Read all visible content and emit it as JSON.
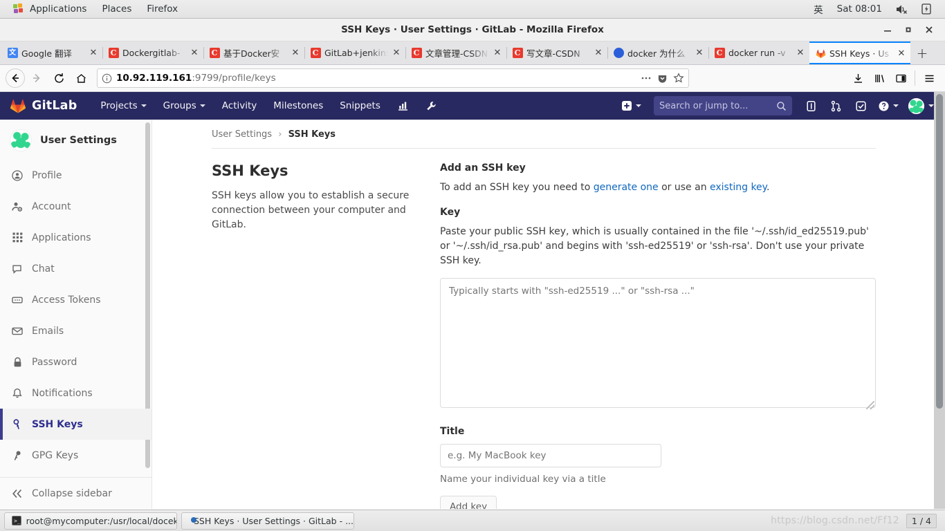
{
  "desktop": {
    "menus": [
      {
        "label": "Applications",
        "icon": "applications-icon"
      },
      {
        "label": "Places",
        "icon": "places-icon"
      },
      {
        "label": "Firefox",
        "icon": "firefox-menu-icon"
      }
    ],
    "indicators": {
      "input_method": "英",
      "clock": "Sat 08:01",
      "volume_icon": "volume-muted-icon",
      "battery_icon": "battery-charging-icon"
    }
  },
  "window": {
    "title": "SSH Keys · User Settings · GitLab - Mozilla Firefox",
    "controls": {
      "minimize": "minimize-icon",
      "maximize": "maximize-icon",
      "close": "close-icon"
    }
  },
  "browser": {
    "tabs": [
      {
        "label": "Google 翻译",
        "favicon": "google-translate",
        "active": false
      },
      {
        "label": "Dockergitlab-",
        "favicon": "csdn",
        "active": false
      },
      {
        "label": "基于Docker安",
        "favicon": "csdn",
        "active": false
      },
      {
        "label": "GitLab+jenkins",
        "favicon": "csdn",
        "active": false
      },
      {
        "label": "文章管理-CSDN",
        "favicon": "csdn",
        "active": false
      },
      {
        "label": "写文章-CSDN",
        "favicon": "csdn",
        "active": false
      },
      {
        "label": "docker 为什么",
        "favicon": "baidu",
        "active": false
      },
      {
        "label": "docker run -v",
        "favicon": "csdn",
        "active": false
      },
      {
        "label": "SSH Keys · Us",
        "favicon": "gitlab",
        "active": true
      }
    ],
    "new_tab_label": "+",
    "close_glyph": "✕",
    "toolbar": {
      "back_icon": "back-arrow-icon",
      "forward_icon": "forward-arrow-icon",
      "reload_icon": "reload-icon",
      "home_icon": "home-icon",
      "downloads_icon": "download-icon",
      "library_icon": "library-icon",
      "sidebar_icon": "sidebar-icon",
      "menu_icon": "hamburger-menu-icon"
    },
    "urlbar": {
      "info_icon": "page-info-icon",
      "host": "10.92.119.161",
      "rest": ":9799/profile/keys",
      "page_actions_icon": "ellipsis-icon",
      "pocket_icon": "pocket-icon",
      "bookmark_icon": "star-icon"
    }
  },
  "gitlab": {
    "brand": "GitLab",
    "nav": [
      {
        "label": "Projects",
        "caret": true
      },
      {
        "label": "Groups",
        "caret": true
      },
      {
        "label": "Activity",
        "caret": false
      },
      {
        "label": "Milestones",
        "caret": false
      },
      {
        "label": "Snippets",
        "caret": false
      }
    ],
    "nav_icons": [
      "analytics-icon",
      "wrench-icon"
    ],
    "right": {
      "new_label": "",
      "plus_icon": "plus-square-icon",
      "search_placeholder": "Search or jump to...",
      "search_icon": "search-icon",
      "issues_icon": "issues-icon",
      "merge_requests_icon": "merge-request-icon",
      "todos_icon": "todos-checkbox-icon",
      "help_icon": "help-question-icon",
      "avatar": "user-avatar"
    }
  },
  "sidebar": {
    "title": "User Settings",
    "avatar": "user-avatar",
    "items": [
      {
        "label": "Profile",
        "icon": "profile-icon",
        "active": false
      },
      {
        "label": "Account",
        "icon": "account-icon",
        "active": false
      },
      {
        "label": "Applications",
        "icon": "applications-grid-icon",
        "active": false
      },
      {
        "label": "Chat",
        "icon": "chat-bubble-icon",
        "active": false
      },
      {
        "label": "Access Tokens",
        "icon": "access-token-icon",
        "active": false
      },
      {
        "label": "Emails",
        "icon": "envelope-icon",
        "active": false
      },
      {
        "label": "Password",
        "icon": "lock-icon",
        "active": false
      },
      {
        "label": "Notifications",
        "icon": "bell-icon",
        "active": false
      },
      {
        "label": "SSH Keys",
        "icon": "key-icon",
        "active": true
      },
      {
        "label": "GPG Keys",
        "icon": "gpg-key-icon",
        "active": false
      }
    ],
    "collapse": {
      "label": "Collapse sidebar",
      "icon": "double-chevron-left-icon"
    }
  },
  "content": {
    "breadcrumb": {
      "root": "User Settings",
      "separator": "›",
      "current": "SSH Keys"
    },
    "left": {
      "heading": "SSH Keys",
      "description": "SSH keys allow you to establish a secure connection between your computer and GitLab."
    },
    "right": {
      "heading": "Add an SSH key",
      "lead_before": "To add an SSH key you need to ",
      "lead_link1": "generate one",
      "lead_middle": " or use an ",
      "lead_link2": "existing key",
      "lead_after": ".",
      "key_label": "Key",
      "key_help": "Paste your public SSH key, which is usually contained in the file '~/.ssh/id_ed25519.pub' or '~/.ssh/id_rsa.pub' and begins with 'ssh-ed25519' or 'ssh-rsa'. Don't use your private SSH key.",
      "key_placeholder": "Typically starts with \"ssh-ed25519 ...\" or \"ssh-rsa ...\"",
      "key_value": "",
      "title_label": "Title",
      "title_placeholder": "e.g. My MacBook key",
      "title_value": "",
      "title_hint": "Name your individual key via a title",
      "submit_label": "Add key"
    }
  },
  "taskbar": {
    "items": [
      {
        "label": "root@mycomputer:/usr/local/docek...",
        "icon": "terminal-icon"
      },
      {
        "label": "SSH Keys · User Settings · GitLab - ...",
        "icon": "firefox-icon"
      }
    ],
    "watermark": "https://blog.csdn.net/Ff12",
    "pager": "1 / 4"
  },
  "colors": {
    "gitlab_navy": "#292961",
    "accent_blue": "#1068bf",
    "active_indigo": "#2e2e8f",
    "tab_active_blue": "#0a84ff"
  }
}
